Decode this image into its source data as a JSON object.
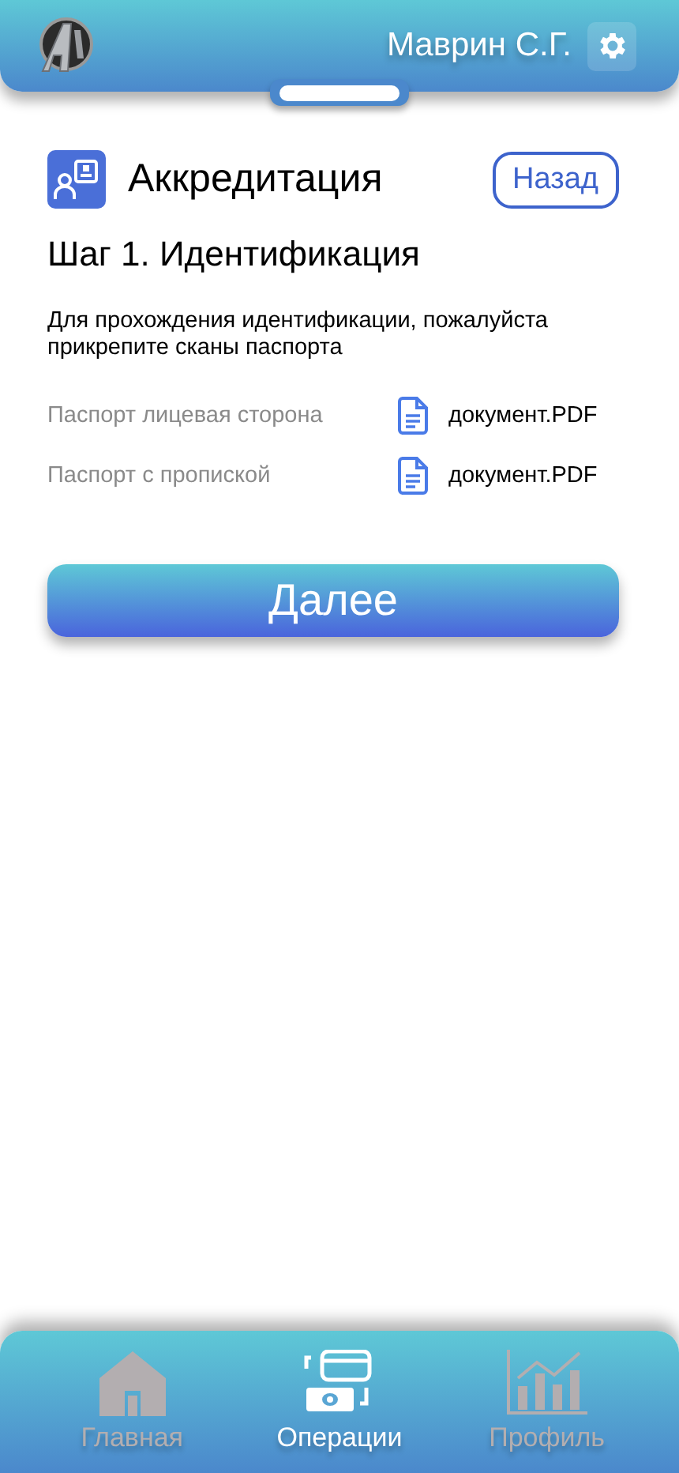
{
  "header": {
    "user_name": "Маврин С.Г."
  },
  "page": {
    "title": "Аккредитация",
    "back_button": "Назад",
    "step_title": "Шаг 1. Идентификация",
    "description": "Для прохождения идентификации, пожалуйста прикрепите сканы паспорта"
  },
  "documents": [
    {
      "label": "Паспорт лицевая сторона",
      "file": "документ.PDF"
    },
    {
      "label": "Паспорт с пропиской",
      "file": "документ.PDF"
    }
  ],
  "next_button": "Далее",
  "bottom_nav": [
    {
      "label": "Главная",
      "selected": false
    },
    {
      "label": "Операции",
      "selected": true
    },
    {
      "label": "Профиль",
      "selected": false
    }
  ]
}
